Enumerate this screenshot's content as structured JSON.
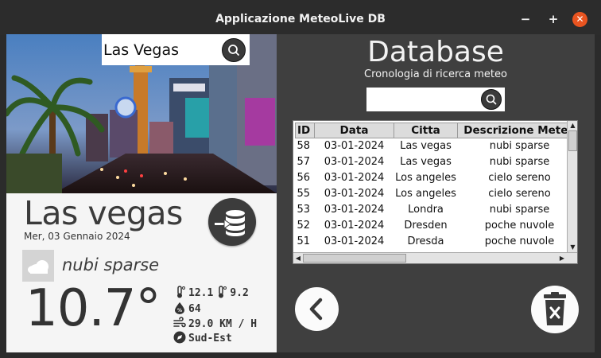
{
  "window": {
    "title": "Applicazione MeteoLive DB",
    "minimize_label": "−",
    "maximize_label": "+",
    "close_label": "✕"
  },
  "left": {
    "search": {
      "value": "Las Vegas"
    },
    "city": "Las vegas",
    "date": "Mer, 03 Gennaio 2024",
    "condition_icon": "cloud-icon",
    "condition": "nubi sparse",
    "temperature": "10.7°",
    "temp_max": "12.1",
    "temp_min": "9.2",
    "humidity": "64",
    "wind": "29.0 KM / H",
    "wind_direction": "Sud-Est"
  },
  "right": {
    "title": "Database",
    "subtitle": "Cronologia di ricerca meteo",
    "search": {
      "value": ""
    },
    "table": {
      "headers": [
        "ID",
        "Data",
        "Citta",
        "Descrizione Meteo"
      ],
      "rows": [
        [
          "58",
          "03-01-2024",
          "Las vegas",
          "nubi sparse"
        ],
        [
          "57",
          "03-01-2024",
          "Las vegas",
          "nubi sparse"
        ],
        [
          "56",
          "03-01-2024",
          "Los angeles",
          "cielo sereno"
        ],
        [
          "55",
          "03-01-2024",
          "Los angeles",
          "cielo sereno"
        ],
        [
          "53",
          "03-01-2024",
          "Londra",
          "nubi sparse"
        ],
        [
          "52",
          "03-01-2024",
          "Dresden",
          "poche nuvole"
        ],
        [
          "51",
          "03-01-2024",
          "Dresda",
          "poche nuvole"
        ]
      ]
    }
  },
  "colors": {
    "titlebar": "#2c2c2c",
    "close_button": "#e95420",
    "right_panel": "#3f3f3f",
    "left_panel": "#f5f5f5"
  }
}
